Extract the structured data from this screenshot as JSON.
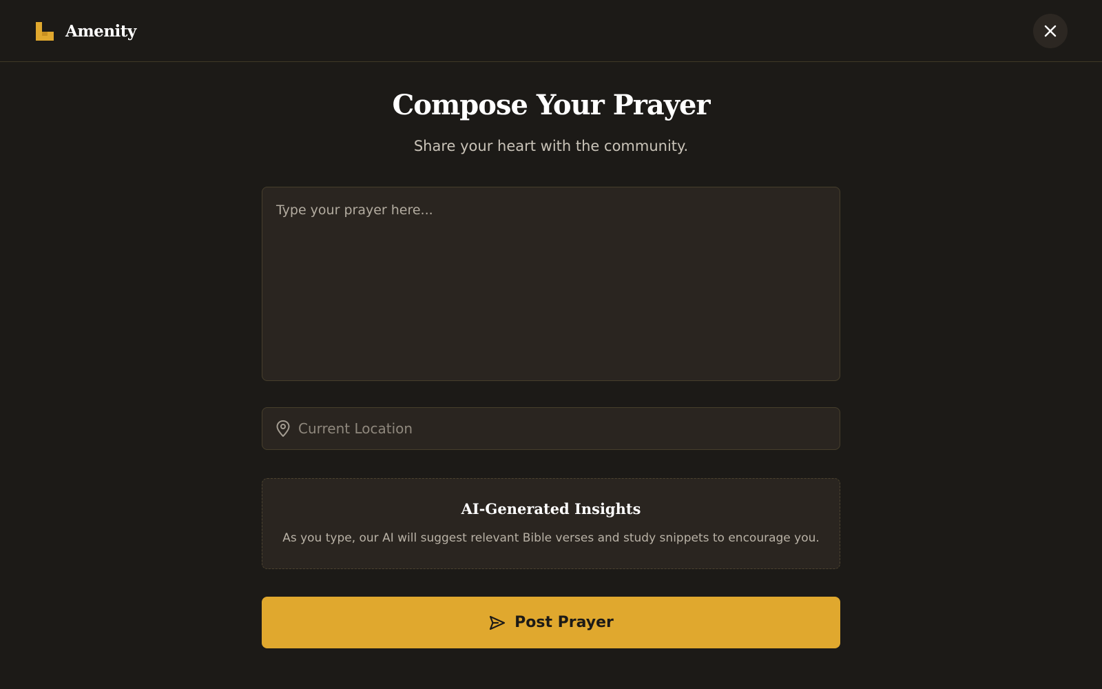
{
  "app": {
    "name": "Amenity",
    "logo_icon": "stair-step-logo-icon",
    "accent_color": "#e0a82e",
    "background_color": "#1c1a17"
  },
  "header": {
    "close_icon": "close-icon"
  },
  "compose": {
    "title": "Compose Your Prayer",
    "subtitle": "Share your heart with the community.",
    "prayer_placeholder": "Type your prayer here...",
    "prayer_value": "",
    "location_icon": "map-pin-icon",
    "location_placeholder": "Current Location",
    "location_value": ""
  },
  "insights": {
    "title": "AI-Generated Insights",
    "description": "As you type, our AI will suggest relevant Bible verses and study snippets to encourage you."
  },
  "actions": {
    "post_icon": "send-icon",
    "post_label": "Post Prayer"
  }
}
